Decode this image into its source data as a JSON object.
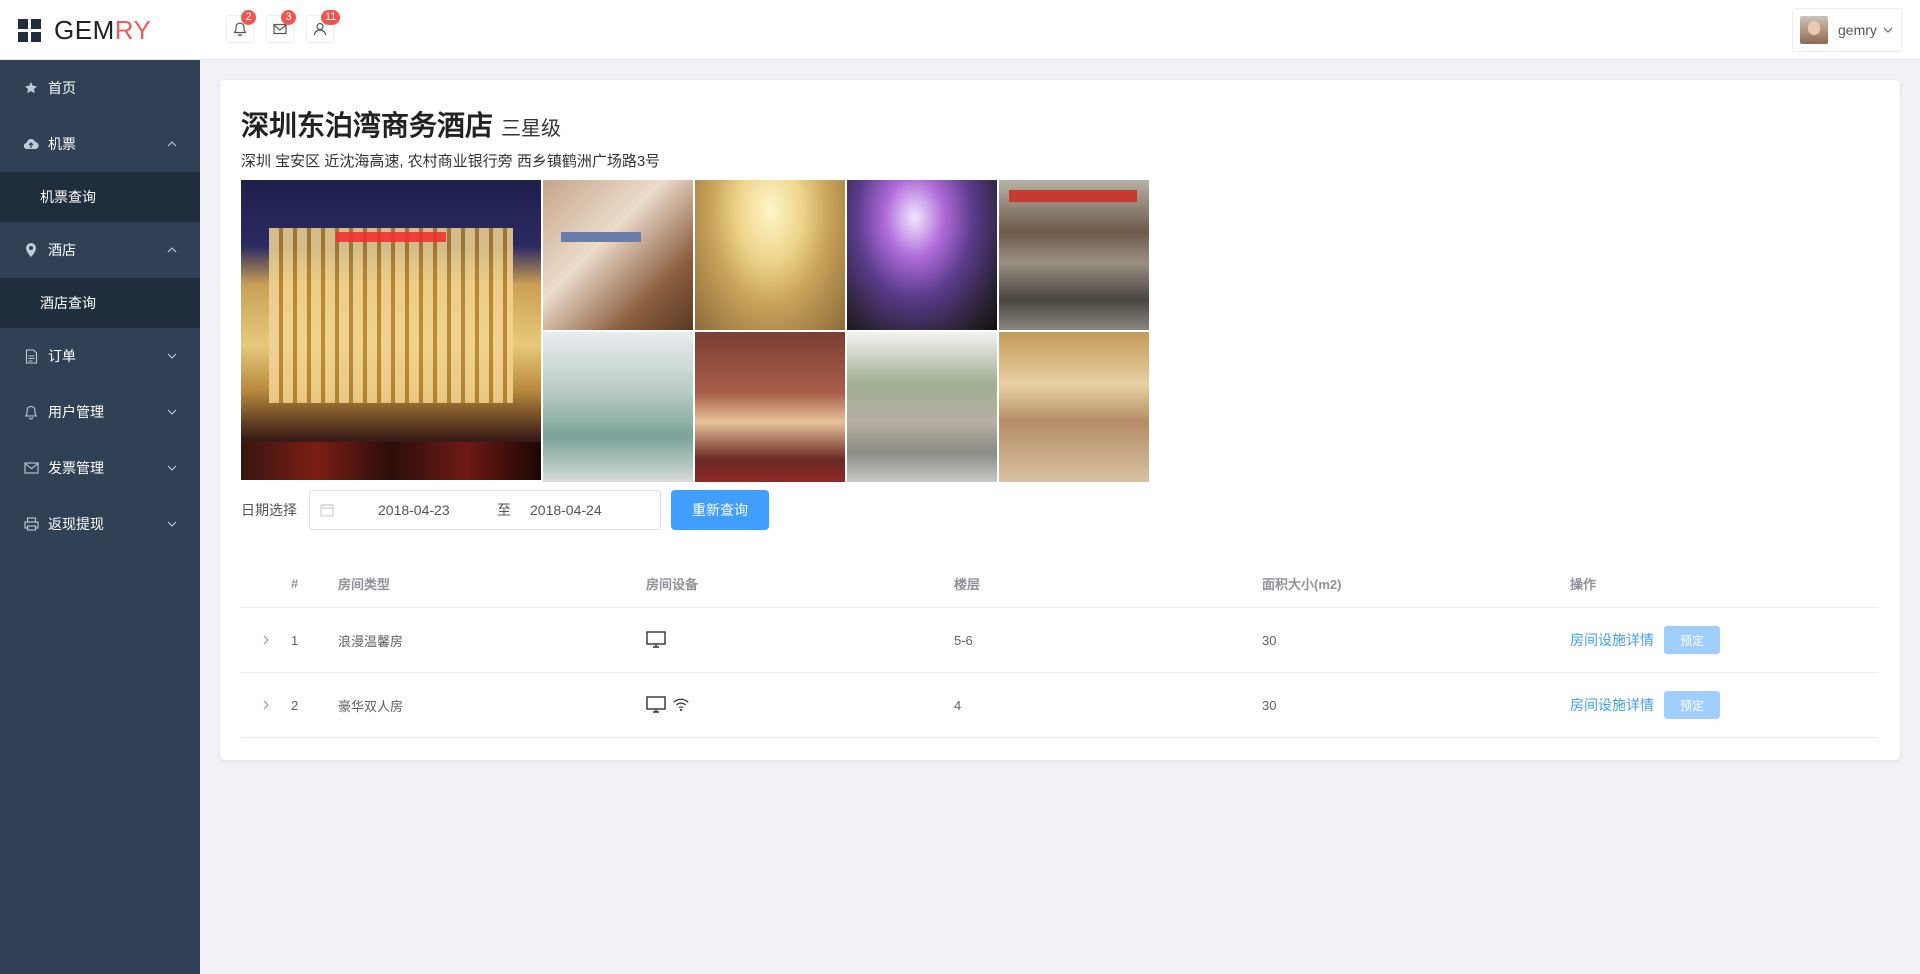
{
  "app": {
    "logo_main": "GEM",
    "logo_accent": "RY",
    "accent_color": "#f25b5b",
    "primary_color": "#409eff"
  },
  "header": {
    "notifications": [
      {
        "icon": "bell-icon",
        "count": "2"
      },
      {
        "icon": "mail-icon",
        "count": "3"
      },
      {
        "icon": "user-icon",
        "count": "11"
      }
    ],
    "user": {
      "name": "gemry"
    }
  },
  "sidebar": {
    "items": [
      {
        "label": "首页",
        "icon": "star-icon"
      },
      {
        "label": "机票",
        "icon": "cloud-upload-icon",
        "expanded": true,
        "children": [
          {
            "label": "机票查询"
          }
        ]
      },
      {
        "label": "酒店",
        "icon": "location-icon",
        "expanded": true,
        "children": [
          {
            "label": "酒店查询"
          }
        ]
      },
      {
        "label": "订单",
        "icon": "document-icon"
      },
      {
        "label": "用户管理",
        "icon": "bell-icon"
      },
      {
        "label": "发票管理",
        "icon": "mail-icon"
      },
      {
        "label": "返现提现",
        "icon": "printer-icon"
      }
    ]
  },
  "hotel": {
    "name": "深圳东泊湾商务酒店",
    "star": "三星级",
    "address": "深圳 宝安区 近沈海高速, 农村商业银行旁 西乡镇鹤洲广场路3号",
    "photo_count": 9
  },
  "search": {
    "label": "日期选择",
    "start_date": "2018-04-23",
    "separator": "至",
    "end_date": "2018-04-24",
    "button": "重新查询"
  },
  "table": {
    "headers": {
      "idx": "#",
      "type": "房间类型",
      "equip": "房间设备",
      "floor": "楼层",
      "area": "面积大小(m2)",
      "action": "操作"
    },
    "rows": [
      {
        "idx": "1",
        "type": "浪漫温馨房",
        "equipment": [
          "monitor-icon"
        ],
        "floor": "5-6",
        "area": "30",
        "detail": "房间设施详情",
        "book": "预定"
      },
      {
        "idx": "2",
        "type": "豪华双人房",
        "equipment": [
          "monitor-icon",
          "wifi-icon"
        ],
        "floor": "4",
        "area": "30",
        "detail": "房间设施详情",
        "book": "预定"
      }
    ]
  }
}
